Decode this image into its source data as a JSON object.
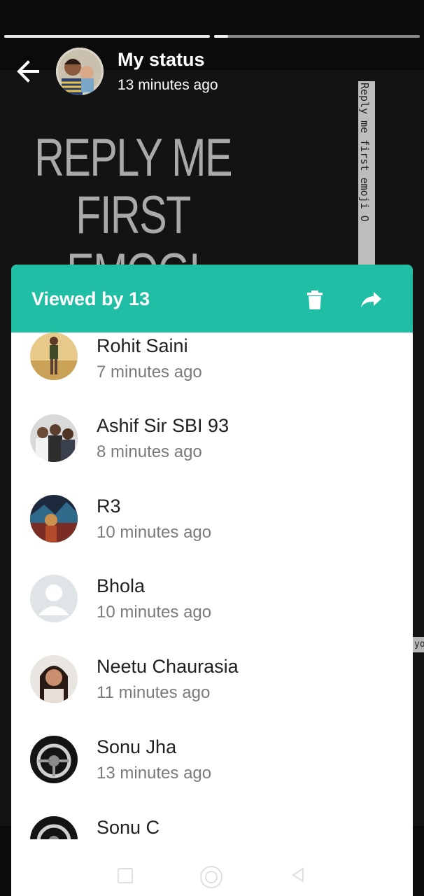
{
  "header": {
    "title": "My status",
    "subtitle": "13 minutes ago"
  },
  "status_content": {
    "main_text": "REPLY ME\nFIRST EMOGI\nON YOUR",
    "side_text": "Reply me first emoji O",
    "edge_text": "yo"
  },
  "viewers_sheet": {
    "title": "Viewed by 13",
    "delete_icon": "trash-icon",
    "forward_icon": "share-icon",
    "accent_color": "#1fbea5",
    "viewers": [
      {
        "name": "Rohit Saini",
        "time": "7 minutes ago"
      },
      {
        "name": "Ashif Sir SBI 93",
        "time": "8 minutes ago"
      },
      {
        "name": "R3",
        "time": "10 minutes ago"
      },
      {
        "name": "Bhola",
        "time": "10 minutes ago"
      },
      {
        "name": "Neetu Chaurasia",
        "time": "11 minutes ago"
      },
      {
        "name": "Sonu Jha",
        "time": "13 minutes ago"
      },
      {
        "name": "Sonu C",
        "time": ""
      }
    ]
  },
  "nav": {
    "recent_icon": "square-icon",
    "home_icon": "circle-icon",
    "back_icon": "triangle-back-icon"
  }
}
